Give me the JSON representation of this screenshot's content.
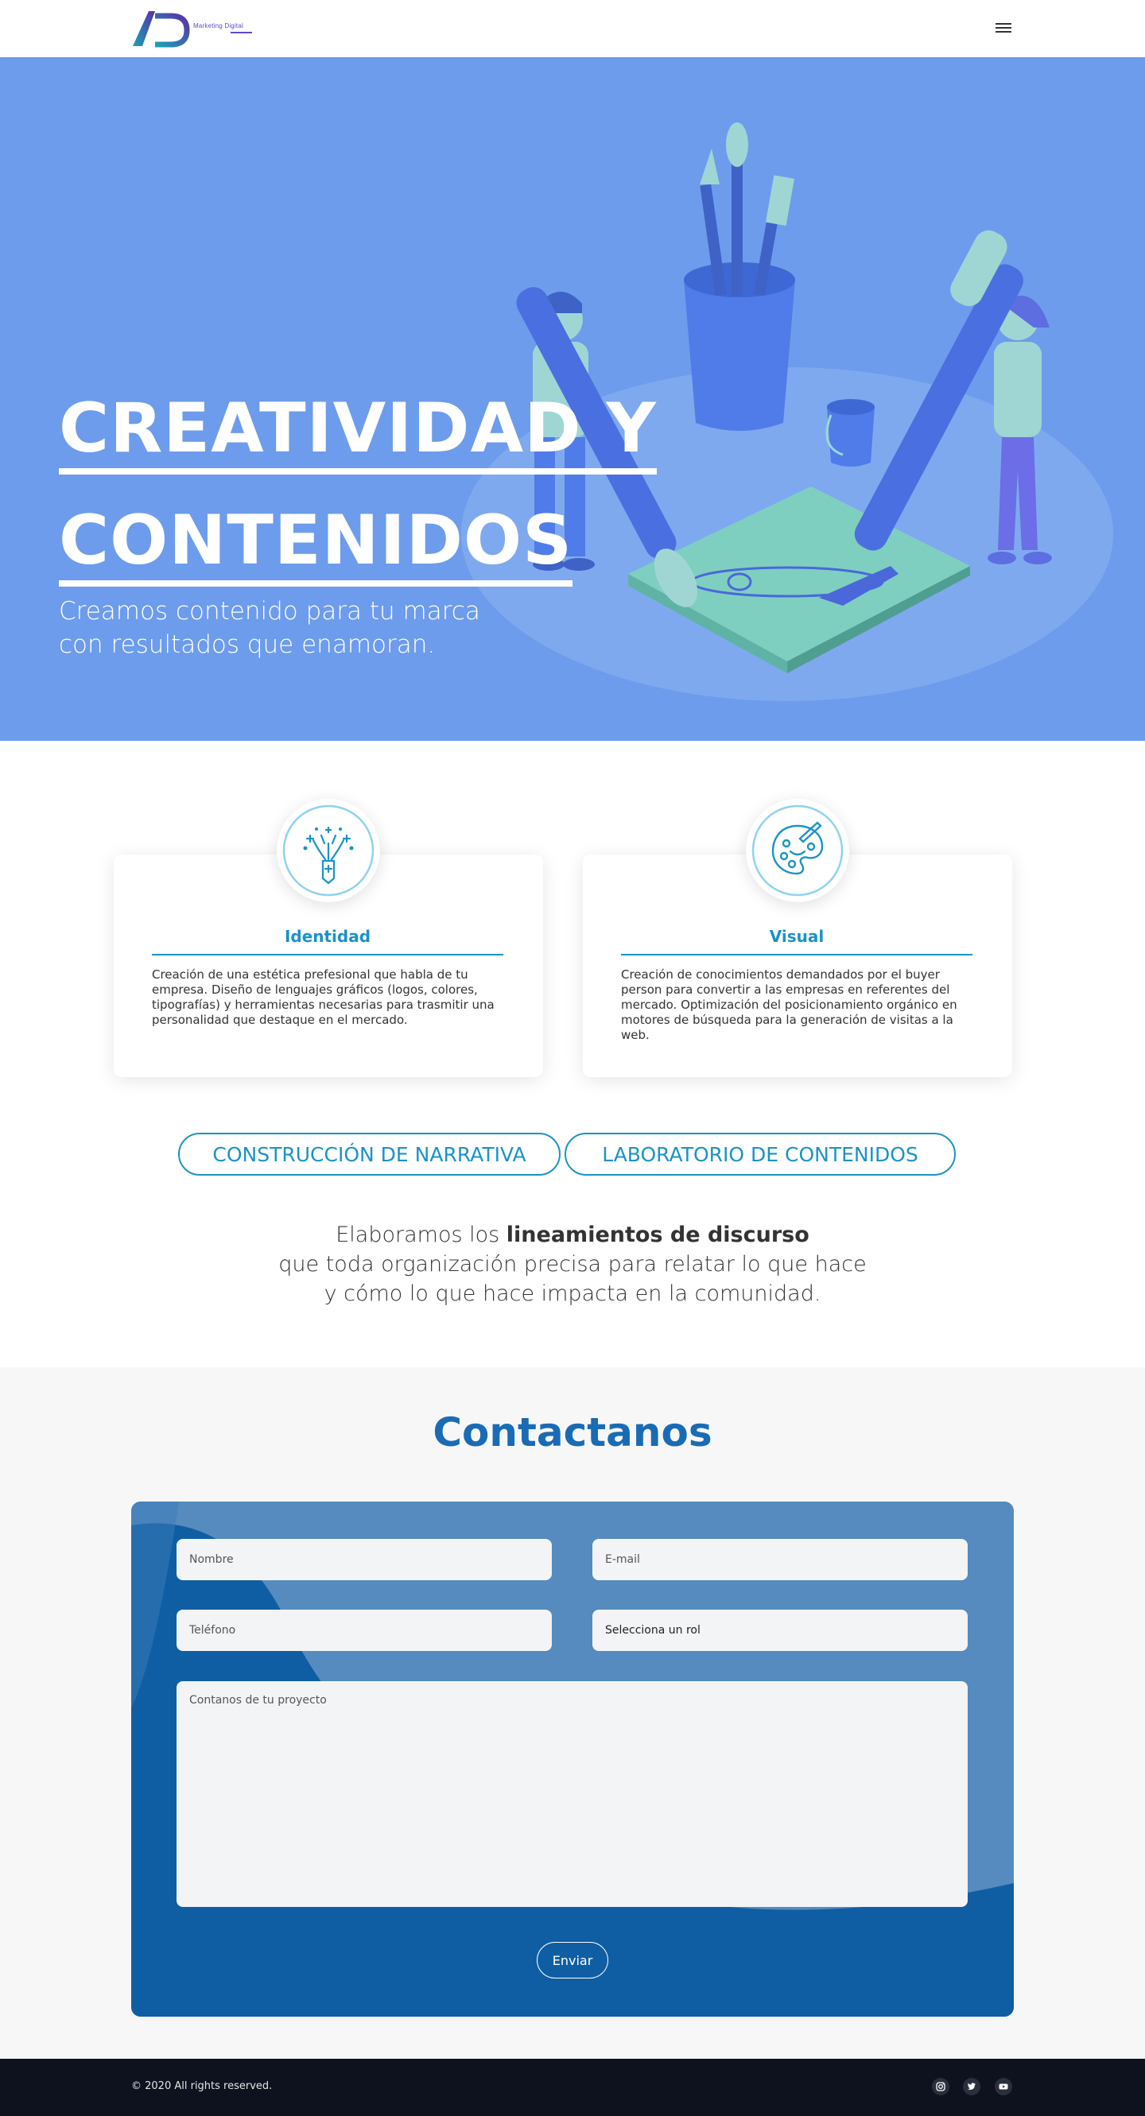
{
  "header": {
    "logo_text": "AD",
    "logo_subtitle": "Marketing Digital",
    "menu_icon": "hamburger-icon"
  },
  "hero": {
    "title_line1": "CREATIVIDAD Y",
    "title_line2": "CONTENIDOS",
    "subtitle_line1": "Creamos contenido para tu marca",
    "subtitle_line2": "con resultados que enamoran."
  },
  "cards": [
    {
      "icon": "fireworks-pencil-icon",
      "title": "Identidad",
      "text": "Creación de una estética prefesional que habla de tu empresa. Diseño de lenguajes gráficos (logos, colores, tipografías) y herramientas necesarias para trasmitir una personalidad que destaque en el mercado."
    },
    {
      "icon": "palette-icon",
      "title": "Visual",
      "text": "Creación de conocimientos demandados por el buyer person para convertir a las empresas en referentes del mercado. Optimización del posicionamiento orgánico en motores de búsqueda para la generación de visitas a la web."
    }
  ],
  "pills": [
    "CONSTRUCCIÓN DE NARRATIVA",
    "LABORATORIO DE CONTENIDOS"
  ],
  "discurso": {
    "pre": "Elaboramos los ",
    "bold": "lineamientos de discurso",
    "line2": "que toda organización precisa para relatar lo que hace",
    "line3": "y cómo lo que hace impacta en la comunidad."
  },
  "contact": {
    "title": "Contactanos",
    "nombre_placeholder": "Nombre",
    "email_placeholder": "E-mail",
    "telefono_placeholder": "Teléfono",
    "rol_selected": "Selecciona un rol",
    "mensaje_placeholder": "Contanos de tu proyecto",
    "submit_label": "Enviar"
  },
  "footer": {
    "copyright": "© 2020 All rights reserved.",
    "social": [
      "instagram-icon",
      "twitter-icon",
      "youtube-icon"
    ]
  },
  "colors": {
    "hero_bg": "#6d9cec",
    "accent": "#1a93c7",
    "contact_title": "#1a6bb5",
    "form_bg": "#558bbf",
    "footer_bg": "#0e121f"
  }
}
